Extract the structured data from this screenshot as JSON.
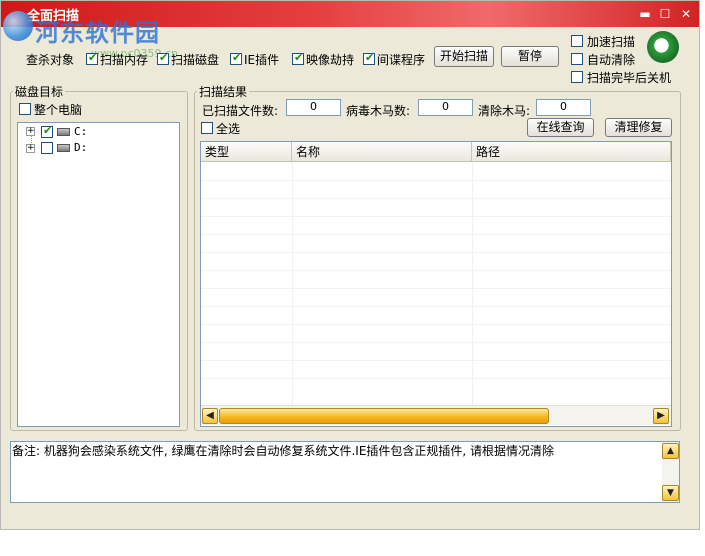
{
  "window": {
    "title": "全面扫描",
    "minimize_glyph": "▬",
    "maximize_glyph": "☐",
    "close_glyph": "✕"
  },
  "watermark": {
    "text": "河东软件园",
    "url": "www.pc0359.cn"
  },
  "toolbar": {
    "scan_target_label": "查杀对象",
    "options": [
      {
        "label": "扫描内存",
        "checked": true
      },
      {
        "label": "扫描磁盘",
        "checked": true
      },
      {
        "label": "IE插件",
        "checked": true
      },
      {
        "label": "映像劫持",
        "checked": true
      },
      {
        "label": "间谍程序",
        "checked": true
      }
    ],
    "start_button": "开始扫描",
    "pause_button": "暂停",
    "right_options": [
      {
        "label": "加速扫描",
        "checked": false
      },
      {
        "label": "自动清除",
        "checked": false
      },
      {
        "label": "扫描完毕后关机",
        "checked": false
      }
    ]
  },
  "disk_panel": {
    "title": "磁盘目标",
    "whole_computer": {
      "label": "整个电脑",
      "checked": false
    },
    "drives": [
      {
        "label": "C:",
        "checked": true
      },
      {
        "label": "D:",
        "checked": false
      }
    ]
  },
  "results": {
    "title": "扫描结果",
    "scanned_label": "已扫描文件数:",
    "scanned_value": "0",
    "virus_label": "病毒木马数:",
    "virus_value": "0",
    "cleaned_label": "清除木马:",
    "cleaned_value": "0",
    "select_all": {
      "label": "全选",
      "checked": false
    },
    "online_query_button": "在线查询",
    "clean_repair_button": "清理修复",
    "columns": [
      "类型",
      "名称",
      "路径"
    ],
    "scroll_left": "◀",
    "scroll_right": "▶"
  },
  "notes": {
    "text": "备注: 机器狗会感染系统文件, 绿鹰在清除时会自动修复系统文件.IE插件包含正规插件, 请根据情况清除",
    "scroll_up": "▲",
    "scroll_down": "▼"
  }
}
